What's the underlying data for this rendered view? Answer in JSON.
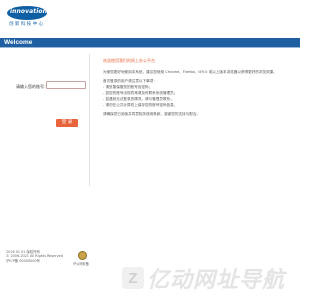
{
  "brand": {
    "logo_text": "innovation",
    "logo_subtitle": "创 新 科 技 中 心"
  },
  "header": {
    "welcome_label": "Welcome"
  },
  "form": {
    "account_label": "请输入您的账号：",
    "account_value": "",
    "submit_label": "登 录"
  },
  "info": {
    "title": "欢迎使用我们的网上办公平台",
    "lines": [
      "为使您更好地使用本系统，建议您使用 Chrome、Firefox、IE9.0 或以上版本浏览器以获得更好的浏览效果。",
      "",
      "首次登录的用户请注意以下事项：",
      "- 请妥善保管您的账号及密码；",
      "- 如您的账号出现异常请及时联系系统管理员；",
      "- 如遇到无法登录的情况，请与管理员联系；",
      "- 请勿在公共计算机上保存您的账号密码信息。",
      "",
      "请确保您已阅读并同意相关使用条款，感谢您的支持与配合。"
    ]
  },
  "footer": {
    "lines": [
      "2016 01 01 版权所有",
      "© 2006-2021 All Rights Reserved",
      "沪ICP备 00000000号"
    ],
    "police_label": "沪公网安备"
  },
  "watermark": {
    "badge": "Z",
    "text": "亿动网址导航"
  }
}
